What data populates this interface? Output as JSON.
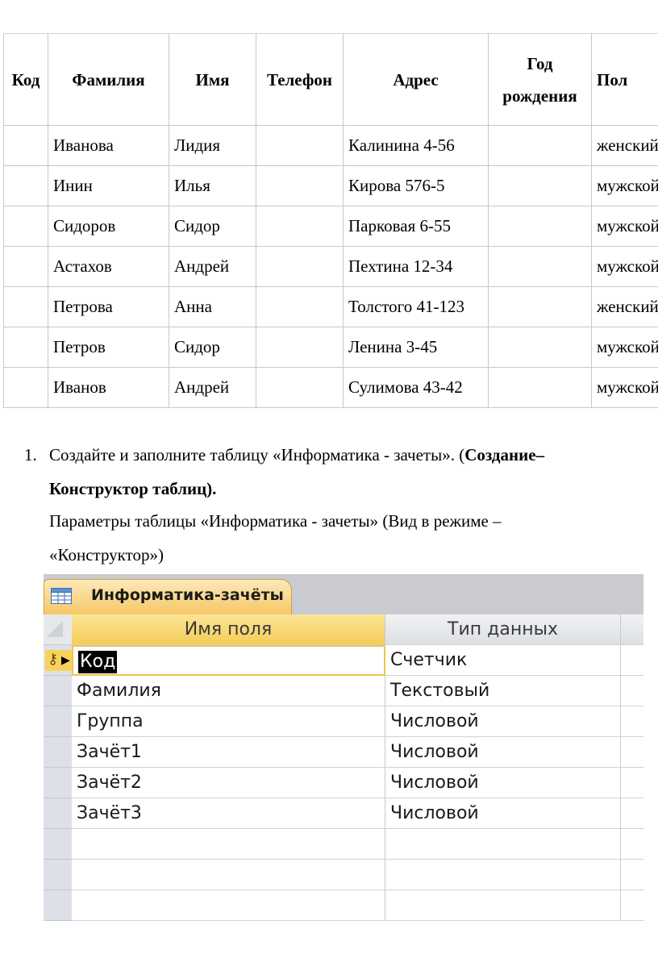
{
  "top_table": {
    "headers": [
      "Код",
      "Фамилия",
      "Имя",
      "Телефон",
      "Адрес",
      "Год рождения",
      "Пол"
    ],
    "rows": [
      [
        "",
        "Иванова",
        "Лидия",
        "",
        "Калинина 4-56",
        "",
        "женский"
      ],
      [
        "",
        "Инин",
        "Илья",
        "",
        "Кирова 576-5",
        "",
        "мужской"
      ],
      [
        "",
        "Сидоров",
        "Сидор",
        "",
        "Парковая 6-55",
        "",
        "мужской"
      ],
      [
        "",
        "Астахов",
        "Андрей",
        "",
        "Пехтина 12-34",
        "",
        "мужской"
      ],
      [
        "",
        "Петрова",
        "Анна",
        "",
        "Толстого 41-123",
        "",
        "женский"
      ],
      [
        "",
        "Петров",
        "Сидор",
        "",
        "Ленина 3-45",
        "",
        "мужской"
      ],
      [
        "",
        "Иванов",
        "Андрей",
        "",
        "Сулимова 43-42",
        "",
        "мужской"
      ]
    ]
  },
  "instruction": {
    "number": "1.",
    "line1_text": "Создайте и заполните таблицу       «Информатика  -  зачеты».  (",
    "line1_bold": "Создание–",
    "line2_bold": "Конструктор таблиц).",
    "line3_text": "Параметры таблицы     «Информатика   -   зачеты»   (Вид в режиме        –",
    "line4_text": "«Конструктор»)"
  },
  "designer": {
    "tab_title": "Информатика-зачёты",
    "column_field_name": "Имя поля",
    "column_data_type": "Тип данных",
    "fields": [
      {
        "name": "Код",
        "type": "Счетчик",
        "primary_key": true
      },
      {
        "name": "Фамилия",
        "type": "Текстовый"
      },
      {
        "name": "Группа",
        "type": "Числовой"
      },
      {
        "name": "Зачёт1",
        "type": "Числовой"
      },
      {
        "name": "Зачёт2",
        "type": "Числовой"
      },
      {
        "name": "Зачёт3",
        "type": "Числовой"
      }
    ],
    "colors": {
      "tab_fill": "#f6c767",
      "header_highlight": "#f5cc58",
      "selector_bg": "#dde1e7"
    }
  }
}
